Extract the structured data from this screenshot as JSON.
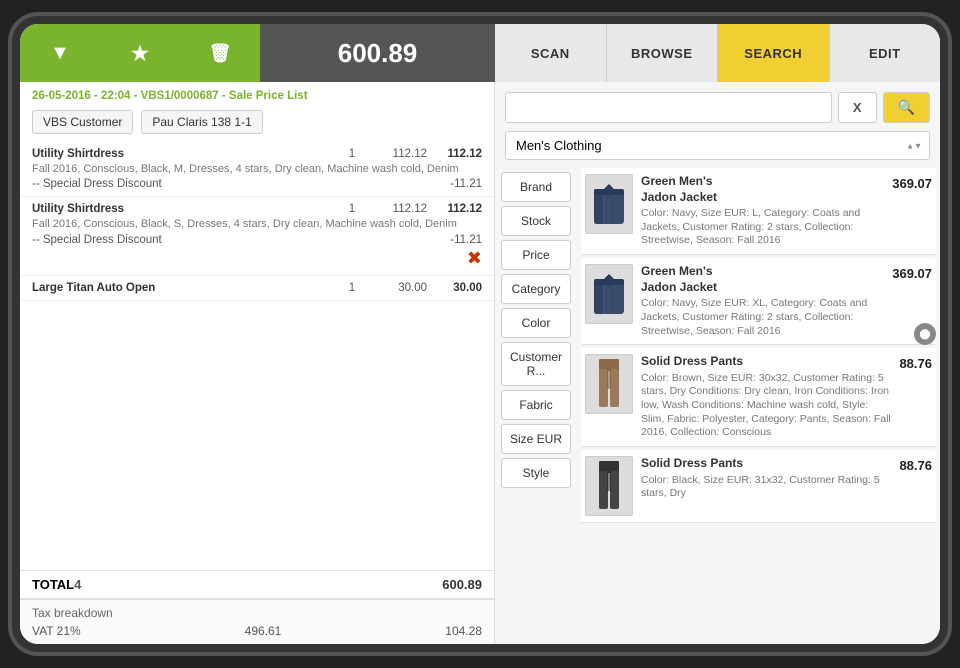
{
  "toolbar": {
    "filter_icon": "▼",
    "star_icon": "★",
    "delete_icon": "🗑",
    "total": "600.89",
    "tabs": [
      "SCAN",
      "BROWSE",
      "SEARCH",
      "EDIT"
    ],
    "active_tab": "SEARCH"
  },
  "order": {
    "header": "26-05-2016 - 22:04 - VBS1/0000687 - Sale Price List",
    "customer": "VBS Customer",
    "location": "Pau Claris 138 1-1",
    "items": [
      {
        "name": "Utility Shirtdress",
        "desc": "Fall 2016, Conscious, Black, M, Dresses, 4 stars, Dry clean, Machine wash cold, Denim",
        "qty": "1",
        "unit_price": "112.12",
        "total": "112.12",
        "discount_label": "-- Special Dress Discount",
        "discount_amount": "-11.21",
        "has_error": false
      },
      {
        "name": "Utility Shirtdress",
        "desc": "Fall 2016, Conscious, Black, S, Dresses, 4 stars, Dry clean, Machine wash cold, Denim",
        "qty": "1",
        "unit_price": "112.12",
        "total": "112.12",
        "discount_label": "-- Special Dress Discount",
        "discount_amount": "-11.21",
        "has_error": true
      },
      {
        "name": "Large Titan Auto Open",
        "desc": "",
        "qty": "1",
        "unit_price": "30.00",
        "total": "30.00",
        "discount_label": "",
        "discount_amount": "",
        "has_error": false
      }
    ],
    "total_row": {
      "label": "TOTAL",
      "qty": "4",
      "amount": "600.89"
    },
    "tax": {
      "section_label": "Tax breakdown",
      "rows": [
        {
          "label": "VAT 21%",
          "base": "496.61",
          "amount": "104.28"
        }
      ]
    }
  },
  "search": {
    "input_placeholder": "",
    "clear_btn": "X",
    "go_btn": "🔍",
    "category": "Men's Clothing",
    "filters": [
      "Brand",
      "Stock",
      "Price",
      "Category",
      "Color",
      "Customer R...",
      "Fabric",
      "Size EUR",
      "Style"
    ]
  },
  "products": [
    {
      "name": "Green Men's\nJadon Jacket",
      "desc": "Color: Navy, Size EUR: L, Category: Coats and Jackets, Customer Rating: 2 stars, Collection: Streetwise, Season: Fall 2016",
      "price": "369.07",
      "type": "jacket"
    },
    {
      "name": "Green Men's\nJadon Jacket",
      "desc": "Color: Navy, Size EUR: XL, Category: Coats and Jackets, Customer Rating: 2 stars, Collection: Streetwise, Season: Fall 2016",
      "price": "369.07",
      "type": "jacket"
    },
    {
      "name": "Solid Dress Pants",
      "desc": "Color: Brown, Size EUR: 30x32, Customer Rating: 5 stars, Dry Conditions: Dry clean, Iron Conditions: Iron low, Wash Conditions: Machine wash cold, Style: Slim, Fabric: Polyester, Category: Pants, Season: Fall 2016, Collection: Conscious",
      "price": "88.76",
      "type": "pants-brown"
    },
    {
      "name": "Solid Dress Pants",
      "desc": "Color: Black, Size EUR: 31x32, Customer Rating: 5 stars, Dry",
      "price": "88.76",
      "type": "pants-black"
    }
  ]
}
